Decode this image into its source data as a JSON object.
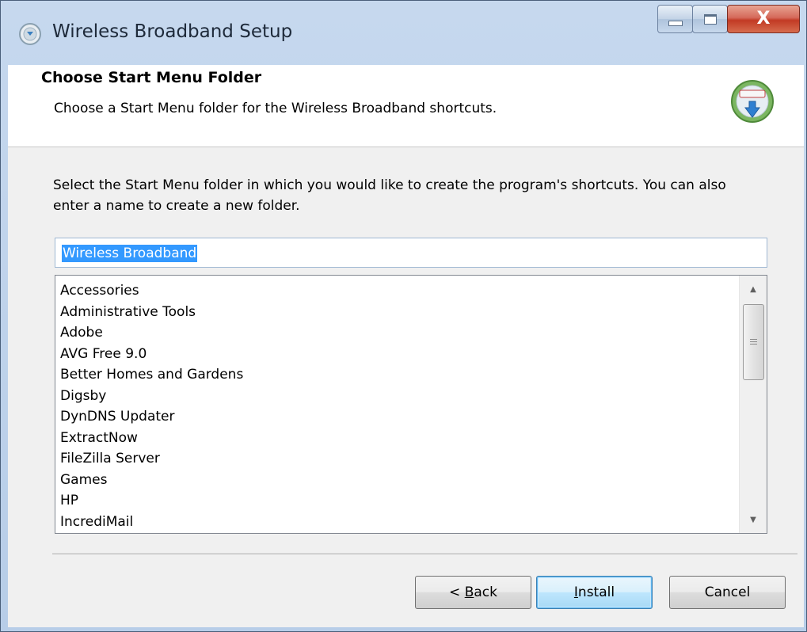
{
  "window": {
    "title": "Wireless Broadband Setup",
    "controls": {
      "minimize": "minimize",
      "maximize": "maximize",
      "close": "X"
    }
  },
  "header": {
    "title": "Choose Start Menu Folder",
    "subtitle": "Choose a Start Menu folder for the Wireless Broadband shortcuts."
  },
  "body": {
    "description": "Select the Start Menu folder in which you would like to create the program's shortcuts. You can also enter a name to create a new folder.",
    "folder_input": {
      "value": "Wireless Broadband"
    },
    "folders": [
      "Accessories",
      "Administrative Tools",
      "Adobe",
      "AVG Free 9.0",
      "Better Homes and Gardens",
      "Digsby",
      "DynDNS Updater",
      "ExtractNow",
      "FileZilla Server",
      "Games",
      "HP",
      "IncrediMail"
    ]
  },
  "buttons": {
    "back": {
      "prefix": "< ",
      "accel": "B",
      "rest": "ack"
    },
    "install": {
      "accel": "I",
      "rest": "nstall"
    },
    "cancel": "Cancel"
  },
  "colors": {
    "selection": "#3399ff",
    "close_button": "#c23a24",
    "frame": "#c6d8ee"
  },
  "icons": {
    "app": "setup-globe-icon",
    "header": "installer-disc-icon",
    "scroll_up": "scroll-up-arrow-icon",
    "scroll_down": "scroll-down-arrow-icon"
  }
}
